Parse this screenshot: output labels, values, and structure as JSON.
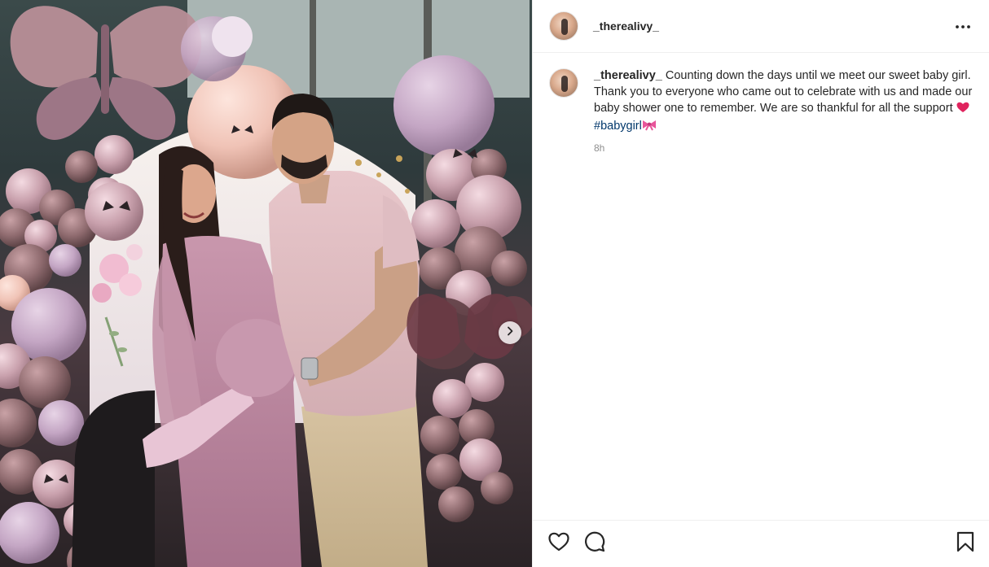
{
  "post": {
    "username": "_therealivy_",
    "caption": {
      "username": "_therealivy_",
      "text": "Counting down the days until we meet our sweet baby girl. Thank you to everyone who came out to celebrate with us and made our baby shower one to remember. We are so thankful for all the support",
      "hashtag": "#babygirl"
    },
    "timestamp": "8h"
  },
  "icons": {
    "more": "more-options-icon",
    "next": "chevron-right-icon",
    "like": "heart-icon",
    "comment": "comment-icon",
    "save": "bookmark-icon",
    "heart_emoji": "red-heart-emoji",
    "ribbon_emoji": "pink-ribbon-emoji"
  },
  "colors": {
    "text": "#262626",
    "secondary": "#8e8e8e",
    "hashtag": "#00376b",
    "border": "#efefef"
  }
}
